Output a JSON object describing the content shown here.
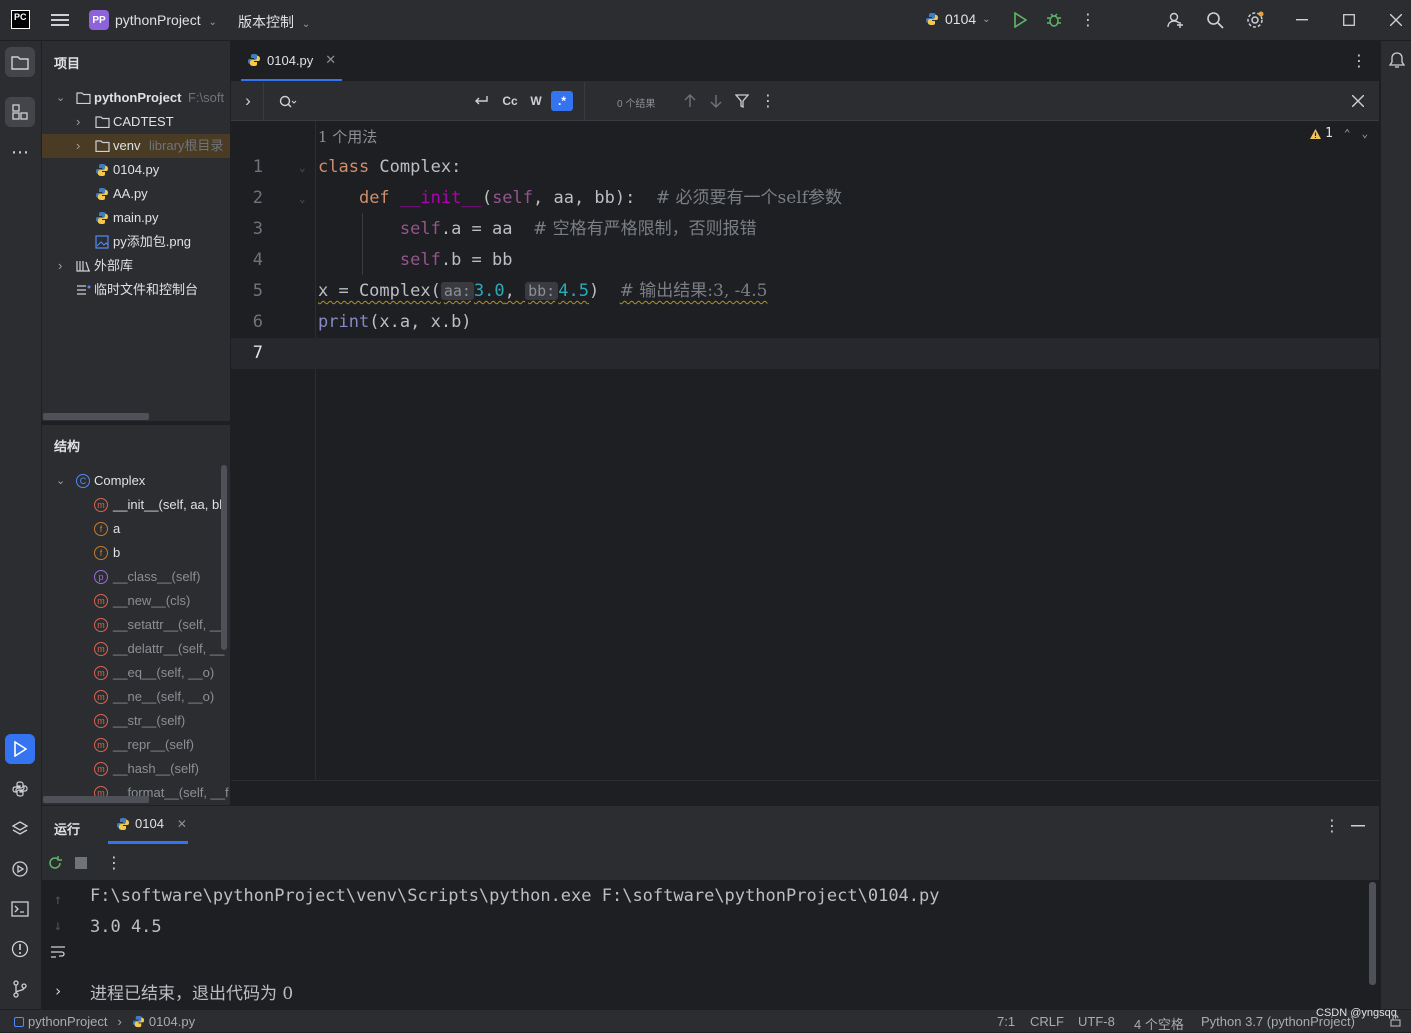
{
  "titlebar": {
    "app_logo": "PC",
    "project_badge": "PP",
    "project_name": "pythonProject",
    "vcs_label": "版本控制",
    "run_config": "0104"
  },
  "project_panel": {
    "title": "项目",
    "tree": [
      {
        "label": "pythonProject",
        "hint": "F:\\soft"
      },
      {
        "label": "CADTEST",
        "hint": ""
      },
      {
        "label": "venv",
        "hint": "library根目录"
      },
      {
        "label": "0104.py",
        "hint": ""
      },
      {
        "label": "AA.py",
        "hint": ""
      },
      {
        "label": "main.py",
        "hint": ""
      },
      {
        "label": "py添加包.png",
        "hint": ""
      },
      {
        "label": "外部库",
        "hint": ""
      },
      {
        "label": "临时文件和控制台",
        "hint": ""
      }
    ]
  },
  "structure_panel": {
    "title": "结构",
    "class_name": "Complex",
    "members": [
      {
        "label": "__init__(self, aa, bb",
        "kind": "m",
        "inherited": false
      },
      {
        "label": "a",
        "kind": "f",
        "inherited": false
      },
      {
        "label": "b",
        "kind": "f",
        "inherited": false
      },
      {
        "label": "__class__(self)",
        "kind": "p",
        "inherited": true
      },
      {
        "label": "__new__(cls)",
        "kind": "m",
        "inherited": true
      },
      {
        "label": "__setattr__(self, __",
        "kind": "m",
        "inherited": true
      },
      {
        "label": "__delattr__(self, __",
        "kind": "m",
        "inherited": true
      },
      {
        "label": "__eq__(self, __o)",
        "kind": "m",
        "inherited": true
      },
      {
        "label": "__ne__(self, __o)",
        "kind": "m",
        "inherited": true
      },
      {
        "label": "__str__(self)",
        "kind": "m",
        "inherited": true
      },
      {
        "label": "__repr__(self)",
        "kind": "m",
        "inherited": true
      },
      {
        "label": "__hash__(self)",
        "kind": "m",
        "inherited": true
      },
      {
        "label": "__format__(self, __f",
        "kind": "m",
        "inherited": true
      }
    ]
  },
  "editor": {
    "tab_name": "0104.py",
    "find": {
      "results": "0 个结果",
      "case_btn": "Cc",
      "word_btn": "W",
      "regex_btn": ".*"
    },
    "usages_hint": "1 个用法",
    "warning_count": "1",
    "line_numbers": [
      "1",
      "2",
      "3",
      "4",
      "5",
      "6",
      "7"
    ],
    "code": {
      "l1_kw": "class",
      "l1_name": " Complex:",
      "l2_kw": "def",
      "l2_fn": "__init__",
      "l2_open": "(",
      "l2_self": "self",
      "l2_args": ", aa, bb):  ",
      "l2_cmt": "# 必须要有一个self参数",
      "l3_self": "self",
      "l3_rest": ".a = aa  ",
      "l3_cmt": "# 空格有严格限制，否则报错",
      "l4_self": "self",
      "l4_rest": ".b = bb",
      "l5_pre": "x = Complex(",
      "l5_hint1": "aa:",
      "l5_v1": "3.0",
      "l5_mid": ", ",
      "l5_hint2": "bb:",
      "l5_v2": "4.5",
      "l5_close": ")  ",
      "l5_cmt": "# 输出结果:3, -4.5",
      "l6_fn": "print",
      "l6_rest": "(x.a, x.b)"
    }
  },
  "run_panel": {
    "title": "运行",
    "tab": "0104",
    "console": [
      "F:\\software\\pythonProject\\venv\\Scripts\\python.exe F:\\software\\pythonProject\\0104.py",
      "3.0 4.5",
      "",
      "进程已结束，退出代码为 0"
    ]
  },
  "statusbar": {
    "crumb_project": "pythonProject",
    "crumb_file": "0104.py",
    "position": "7:1",
    "line_sep": "CRLF",
    "encoding": "UTF-8",
    "indent": "4 个空格",
    "interpreter": "Python 3.7 (pythonProject)",
    "watermark": "CSDN @yngsqq"
  }
}
